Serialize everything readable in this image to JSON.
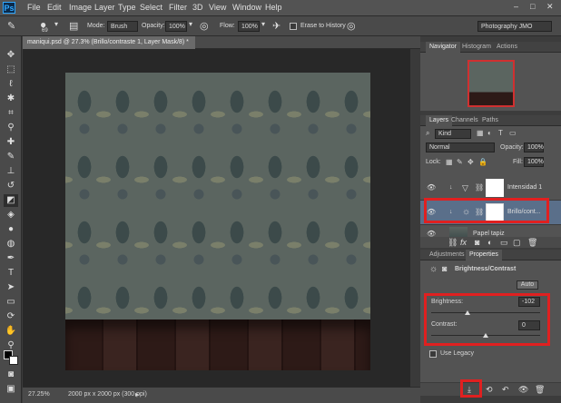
{
  "menubar": {
    "logo": "Ps",
    "items": [
      "File",
      "Edit",
      "Image",
      "Layer",
      "Type",
      "Select",
      "Filter",
      "3D",
      "View",
      "Window",
      "Help"
    ],
    "window_controls": [
      "–",
      "□",
      "✕"
    ]
  },
  "options": {
    "brush_size": "69",
    "mode_label": "Mode:",
    "mode_value": "Brush",
    "opacity_label": "Opacity:",
    "opacity_value": "100%",
    "flow_label": "Flow:",
    "flow_value": "100%",
    "erase_label": "Erase to History",
    "workspace": "Photography JMO"
  },
  "document": {
    "tab_title": "maniqui.psd @ 27.3% (Brillo/contraste 1, Layer Mask/8) *",
    "tab_close": "×"
  },
  "status": {
    "zoom": "27.25%",
    "doc_info": "2000 px x 2000 px (300 ppi)"
  },
  "navigator": {
    "tabs": [
      "Navigator",
      "Histogram",
      "Actions"
    ]
  },
  "layers": {
    "tabs": [
      "Layers",
      "Channels",
      "Paths"
    ],
    "kind": "Kind",
    "blend": "Normal",
    "opacity_label": "Opacity:",
    "opacity_value": "100%",
    "lock_label": "Lock:",
    "fill_label": "Fill:",
    "fill_value": "100%",
    "items": [
      {
        "name": "Intensidad 1"
      },
      {
        "name": "Brillo/cont..."
      },
      {
        "name": "Papel tapiz"
      }
    ]
  },
  "properties": {
    "tabs": [
      "Adjustments",
      "Properties"
    ],
    "title": "Brightness/Contrast",
    "auto_label": "Auto",
    "brightness_label": "Brightness:",
    "brightness_value": "-102",
    "contrast_label": "Contrast:",
    "contrast_value": "0",
    "legacy_label": "Use Legacy",
    "brightness_level": 0.33,
    "contrast_level": 0.5
  },
  "colors": {
    "highlight": "#e02020",
    "selected_layer": "#5a6f8a"
  }
}
